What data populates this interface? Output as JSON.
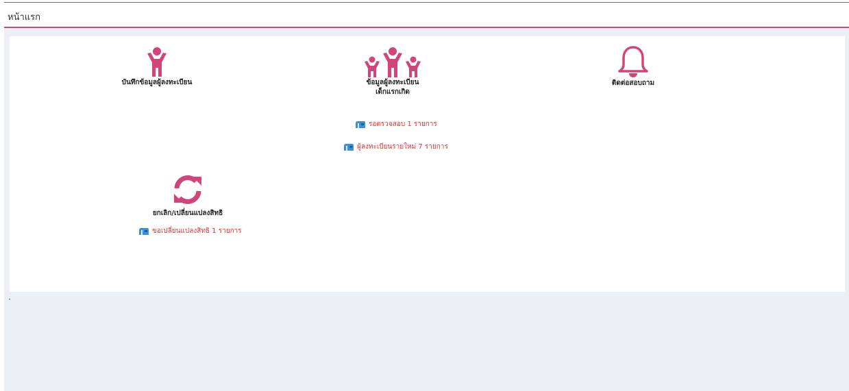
{
  "header": {
    "title": "หน้าแรก"
  },
  "tiles": [
    {
      "label": "บันทึกข้อมูลผู้ลงทะเบียน",
      "icon": "child-icon"
    },
    {
      "label_line1": "ข้อมูลผู้ลงทะเบียน",
      "label_line2": "เด็กแรกเกิด",
      "icon": "children-group-icon"
    },
    {
      "label": "ติดต่อสอบถาม",
      "icon": "bell-icon"
    },
    {
      "label": "ยกเลิก/เปลี่ยนแปลงสิทธิ",
      "icon": "sync-icon"
    }
  ],
  "notices": [
    {
      "text": "รอตรวจสอบ 1 รายการ",
      "icon": "mailbox-icon"
    },
    {
      "text": "ผู้ลงทะเบียนรายใหม่ 7 รายการ",
      "icon": "mailbox-icon"
    },
    {
      "text": "ขอเปลี่ยนแปลงสิทธิ 1 รายการ",
      "icon": "mailbox-icon"
    }
  ],
  "colors": {
    "accent": "#d1457a",
    "header_border_top": "#6f5fa8",
    "notice_text": "#e53232",
    "mailbox_blue": "#3d8fd6",
    "background": "#eceff3"
  }
}
